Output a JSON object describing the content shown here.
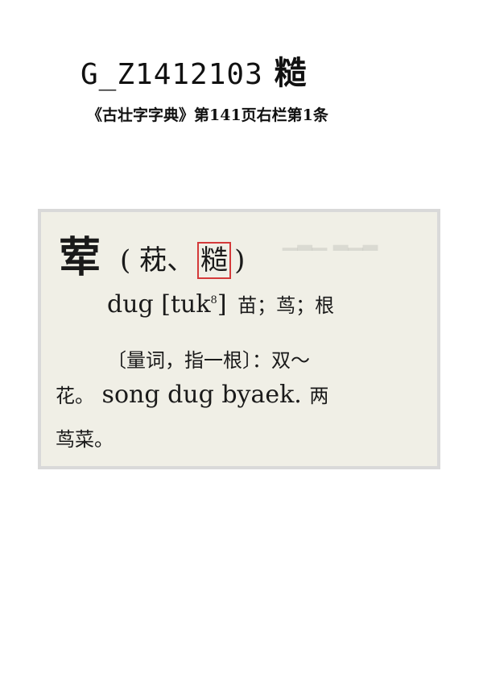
{
  "header": {
    "code": "G_Z1412103",
    "glyph": "糙"
  },
  "source": {
    "reference": "《古壮字字典》第141页右栏第1条"
  },
  "entry": {
    "headword": "荤",
    "variant_open": "(",
    "variant_1": "萙、",
    "variant_highlight": "糙",
    "variant_close": ")",
    "pronunciation": "dug [tuk",
    "tone": "8",
    "bracket_close": "]",
    "meaning_1": "苗；茑；根",
    "usage_note": "〔量词，指一根〕：双～",
    "line3_zh_lead": "花。",
    "example_zhuang": "song dug byaek.",
    "line3_zh_tail": "两",
    "line4": "茑菜。"
  },
  "colors": {
    "highlight_box": "#d43a3a",
    "scan_background": "#f0efe6"
  }
}
